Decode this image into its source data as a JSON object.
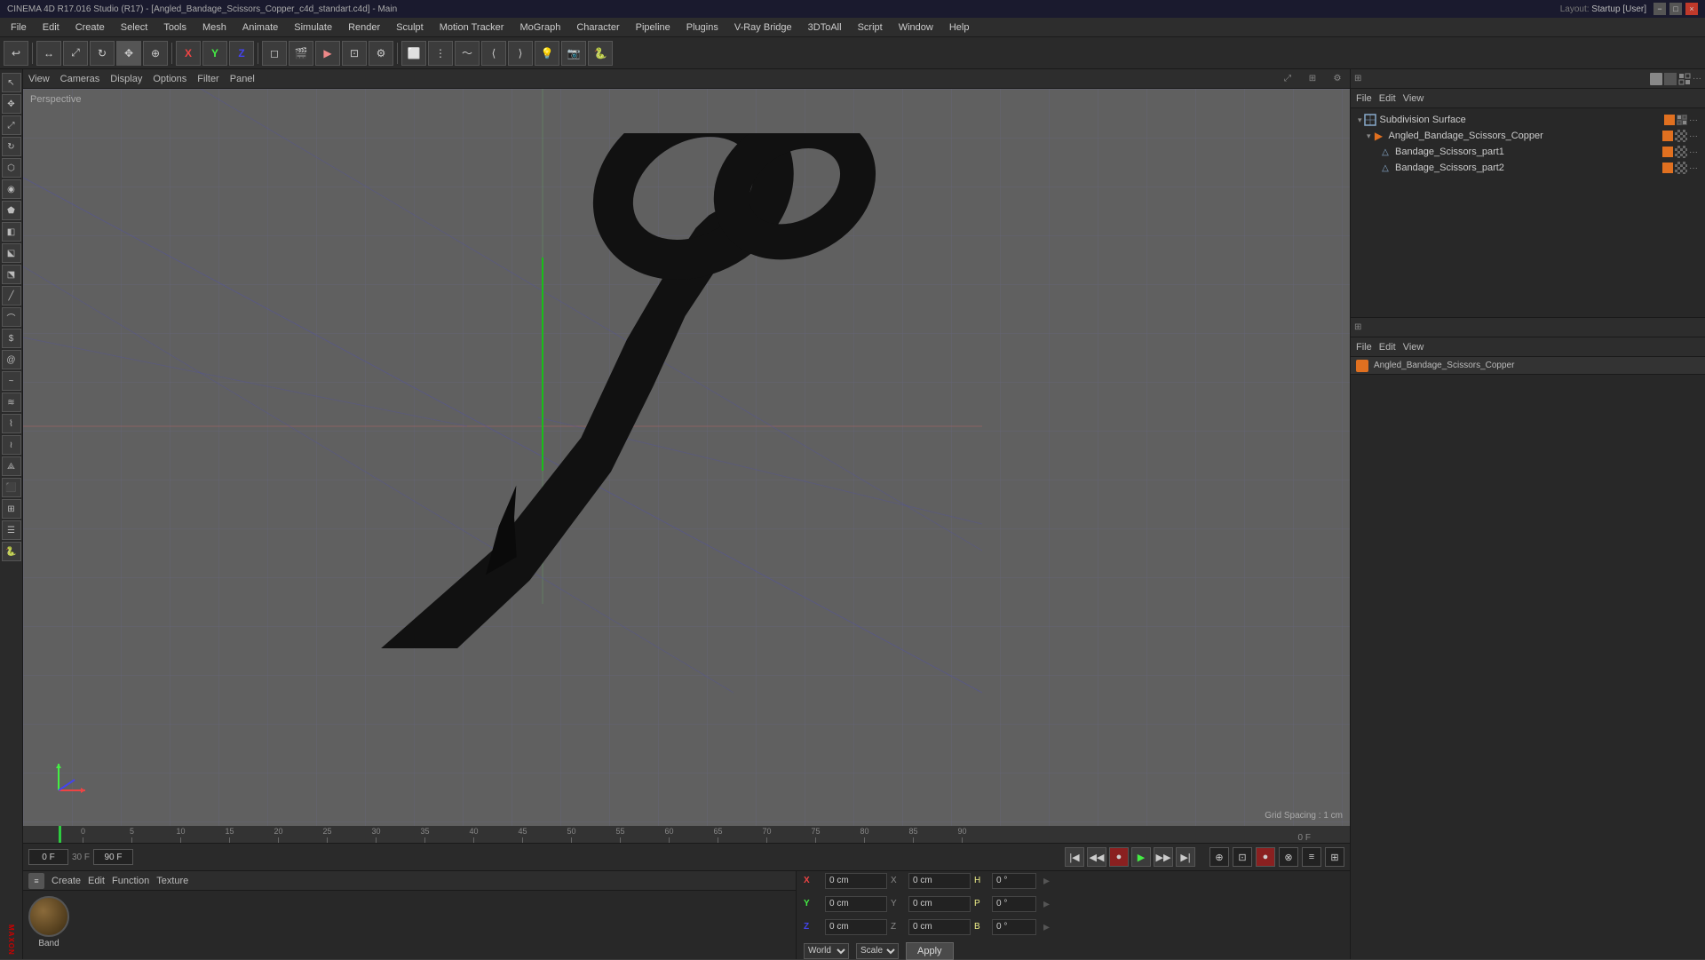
{
  "titlebar": {
    "title": "CINEMA 4D R17.016 Studio (R17) - [Angled_Bandage_Scissors_Copper_c4d_standart.c4d] - Main",
    "layout_label": "Layout:",
    "layout_value": "Startup [User]",
    "win_min": "−",
    "win_max": "□",
    "win_close": "×"
  },
  "menubar": {
    "items": [
      "File",
      "Edit",
      "Create",
      "Select",
      "Tools",
      "Mesh",
      "Animate",
      "Simulate",
      "Render",
      "Sculpt",
      "Motion Tracker",
      "MoGraph",
      "Character",
      "Pipeline",
      "Plugins",
      "V-Ray Bridge",
      "3DToAll",
      "Script",
      "Window",
      "Help"
    ]
  },
  "viewport": {
    "label": "Perspective",
    "grid_spacing": "Grid Spacing : 1 cm",
    "menus": [
      "View",
      "Cameras",
      "Display",
      "Options",
      "Filter",
      "Panel"
    ]
  },
  "timeline": {
    "frame_markers": [
      "0",
      "5",
      "10",
      "15",
      "20",
      "25",
      "30",
      "35",
      "40",
      "45",
      "50",
      "55",
      "60",
      "65",
      "70",
      "75",
      "80",
      "85",
      "90"
    ],
    "current_frame": "0 F",
    "start_frame": "0 F",
    "fps": "30 F",
    "end_frame": "90 F",
    "frame_display": "0 F"
  },
  "object_manager": {
    "toolbar": [
      "File",
      "Edit",
      "View"
    ],
    "items": [
      {
        "name": "Subdivision Surface",
        "level": 0,
        "type": "subdivision",
        "has_children": true
      },
      {
        "name": "Angled_Bandage_Scissors_Copper",
        "level": 1,
        "type": "group"
      },
      {
        "name": "Bandage_Scissors_part1",
        "level": 2,
        "type": "mesh"
      },
      {
        "name": "Bandage_Scissors_part2",
        "level": 2,
        "type": "mesh"
      }
    ]
  },
  "attribute_manager": {
    "toolbar": [
      "File",
      "Edit",
      "View"
    ],
    "selected_object": "Angled_Bandage_Scissors_Copper",
    "coords": {
      "x_label": "X",
      "x_pos": "0 cm",
      "x_size": "0 cm",
      "y_label": "Y",
      "y_pos": "0 cm",
      "y_size": "0 cm",
      "z_label": "Z",
      "z_pos": "0 cm",
      "z_size": "0 cm",
      "h_label": "H",
      "h_val": "0 °",
      "p_label": "P",
      "p_val": "0 °",
      "b_label": "B",
      "b_val": "0 °",
      "coord_system": "World",
      "scale_mode": "Scale",
      "apply_label": "Apply"
    }
  },
  "bottom_panel": {
    "toolbar": [
      "Create",
      "Edit",
      "Function",
      "Texture"
    ],
    "material": {
      "name": "Band"
    }
  },
  "icons": {
    "move": "↔",
    "rotate": "↻",
    "scale": "⤢",
    "play": "▶",
    "stop": "■",
    "prev": "◀◀",
    "next": "▶▶",
    "prev_frame": "◀",
    "next_frame": "▶",
    "record": "●",
    "first_frame": "|◀",
    "last_frame": "▶|"
  }
}
